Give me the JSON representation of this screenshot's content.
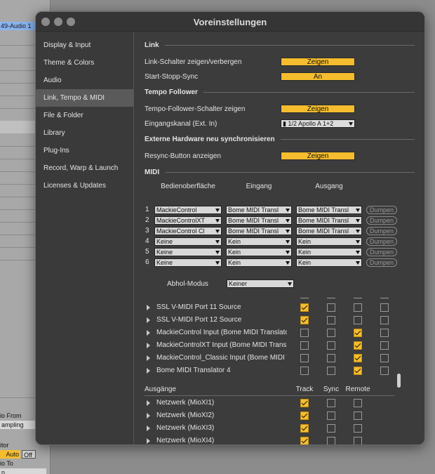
{
  "background": {
    "track_tag": "49-Audio 1",
    "audio_from_label": "io From",
    "sampling_label": "ampling",
    "monitor_label": "itor",
    "auto_label": "Auto",
    "off_label": "Off",
    "audio_to_label": "io To",
    "bottom_select": "n"
  },
  "window": {
    "title": "Voreinstellungen"
  },
  "sidebar": {
    "items": [
      {
        "label": "Display & Input"
      },
      {
        "label": "Theme & Colors"
      },
      {
        "label": "Audio"
      },
      {
        "label": "Link, Tempo & MIDI"
      },
      {
        "label": "File & Folder"
      },
      {
        "label": "Library"
      },
      {
        "label": "Plug-Ins"
      },
      {
        "label": "Record, Warp & Launch"
      },
      {
        "label": "Licenses & Updates"
      }
    ],
    "active_index": 3
  },
  "link": {
    "section": "Link",
    "toggle_label": "Link-Schalter zeigen/verbergen",
    "toggle_value": "Zeigen",
    "sync_label": "Start-Stopp-Sync",
    "sync_value": "An"
  },
  "tempo": {
    "section": "Tempo Follower",
    "toggle_label": "Tempo-Follower-Schalter zeigen",
    "toggle_value": "Zeigen",
    "input_label": "Eingangskanal (Ext. In)",
    "input_value": "1/2 Apollo A 1+2"
  },
  "resync": {
    "section": "Externe Hardware neu synchronisieren",
    "label": "Resync-Button anzeigen",
    "value": "Zeigen"
  },
  "midi": {
    "section": "MIDI",
    "col_surface": "Bedienoberfläche",
    "col_input": "Eingang",
    "col_output": "Ausgang",
    "dump_label": "Dumpen",
    "rows": [
      {
        "num": "1",
        "surface": "MackieControl",
        "input": "Bome MIDI Transl",
        "output": "Bome MIDI Transl"
      },
      {
        "num": "2",
        "surface": "MackieControlXT",
        "input": "Bome MIDI Transl",
        "output": "Bome MIDI Transl"
      },
      {
        "num": "3",
        "surface": "MackieControl Cl",
        "input": "Bome MIDI Transl",
        "output": "Bome MIDI Transl"
      },
      {
        "num": "4",
        "surface": "Keine",
        "input": "Kein",
        "output": "Kein"
      },
      {
        "num": "5",
        "surface": "Keine",
        "input": "Kein",
        "output": "Kein"
      },
      {
        "num": "6",
        "surface": "Keine",
        "input": "Kein",
        "output": "Kein"
      }
    ],
    "takeover_label": "Abhol-Modus",
    "takeover_value": "Keiner"
  },
  "ports_in": [
    {
      "name": "SSL V-MIDI Port 11 Source",
      "checks": [
        true,
        false,
        false,
        false
      ]
    },
    {
      "name": "SSL V-MIDI Port 12 Source",
      "checks": [
        true,
        false,
        false,
        false
      ]
    },
    {
      "name": "MackieControl Input (Bome MIDI Translator)",
      "checks": [
        false,
        false,
        true,
        false
      ]
    },
    {
      "name": "MackieControlXT Input (Bome MIDI Translator)",
      "checks": [
        false,
        false,
        true,
        false
      ]
    },
    {
      "name": "MackieControl_Classic Input (Bome MIDI Translator)",
      "checks": [
        false,
        false,
        true,
        false
      ]
    },
    {
      "name": "Bome MIDI Translator 4",
      "checks": [
        false,
        false,
        true,
        false
      ]
    }
  ],
  "outputs": {
    "section": "Ausgänge",
    "col_track": "Track",
    "col_sync": "Sync",
    "col_remote": "Remote",
    "ports": [
      {
        "name": "Netzwerk (MioXI1)",
        "checks": [
          true,
          false,
          false
        ]
      },
      {
        "name": "Netzwerk (MioXI2)",
        "checks": [
          true,
          false,
          false
        ]
      },
      {
        "name": "Netzwerk (MioXI3)",
        "checks": [
          true,
          false,
          false
        ]
      },
      {
        "name": "Netzwerk (MioXI4)",
        "checks": [
          true,
          false,
          false
        ]
      }
    ]
  },
  "colors": {
    "accent": "#f5bd2e",
    "dialog_bg": "#3c3c3c",
    "active_sidebar": "#5a5a5a"
  }
}
